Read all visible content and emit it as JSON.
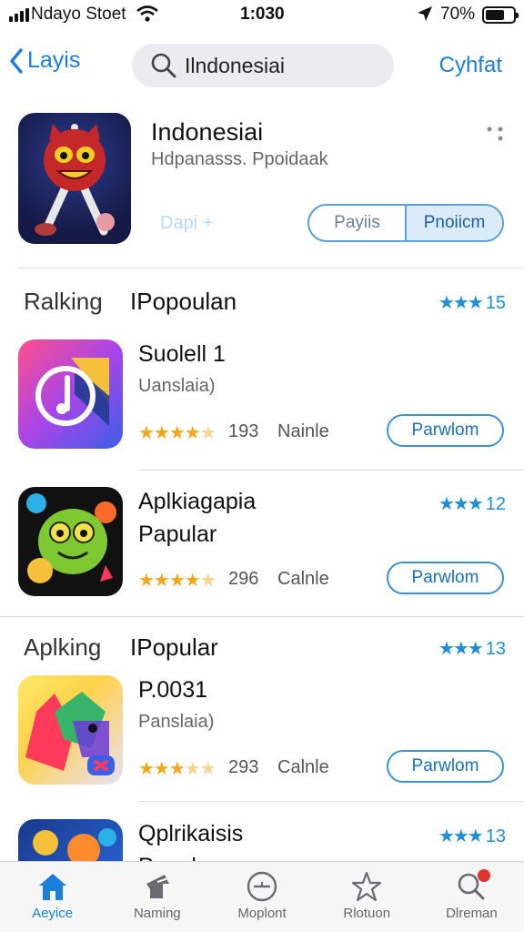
{
  "status_bar": {
    "carrier": "Ndayo Stoet",
    "time": "1:030",
    "battery": "70%",
    "battery_level": 0.7
  },
  "nav": {
    "back_label": "Layis",
    "search_query": "Ilndonesiai",
    "right_action": "Cyhfat"
  },
  "featured": {
    "title": "Indonesiai",
    "subtitle": "Hdpanasss. Ppoidaak",
    "ghost_label": "Dapi +",
    "segments": [
      "Payiis",
      "Pnoiicm"
    ],
    "selected_segment": 1
  },
  "sections": [
    {
      "label_a": "Ralking",
      "label_b": "IPopoulan",
      "rating": "15"
    },
    {
      "label_a": "Aplking",
      "label_b": "IPopular",
      "rating": "13"
    }
  ],
  "apps": [
    {
      "name": "Suolell 1",
      "sub": "Uanslaia)",
      "stars": 4.5,
      "count": "193",
      "genre": "Nainle",
      "button": "Parwlom"
    },
    {
      "name": "Aplkiagapia",
      "name2": "Papular",
      "rank": "12",
      "stars": 4.5,
      "count": "296",
      "genre": "Calnle",
      "button": "Parwlom"
    },
    {
      "name": "P.0031",
      "sub": "Panslaia)",
      "stars": 3.5,
      "count": "293",
      "genre": "Calnle",
      "button": "Parwlom"
    },
    {
      "name": "Qplrikaisis",
      "name2": "Papular",
      "rank": "13"
    }
  ],
  "tabs": [
    {
      "label": "Aeyice",
      "icon": "home-icon",
      "active": true
    },
    {
      "label": "Naming",
      "icon": "hat-icon",
      "active": false
    },
    {
      "label": "Moplont",
      "icon": "compass-icon",
      "active": false
    },
    {
      "label": "Rlotuon",
      "icon": "star-icon",
      "active": false
    },
    {
      "label": "Dlreman",
      "icon": "search-icon",
      "active": false,
      "badge": true
    }
  ],
  "colors": {
    "accent": "#1a7fdb",
    "star": "#f0a818",
    "badge": "#e0332e"
  }
}
